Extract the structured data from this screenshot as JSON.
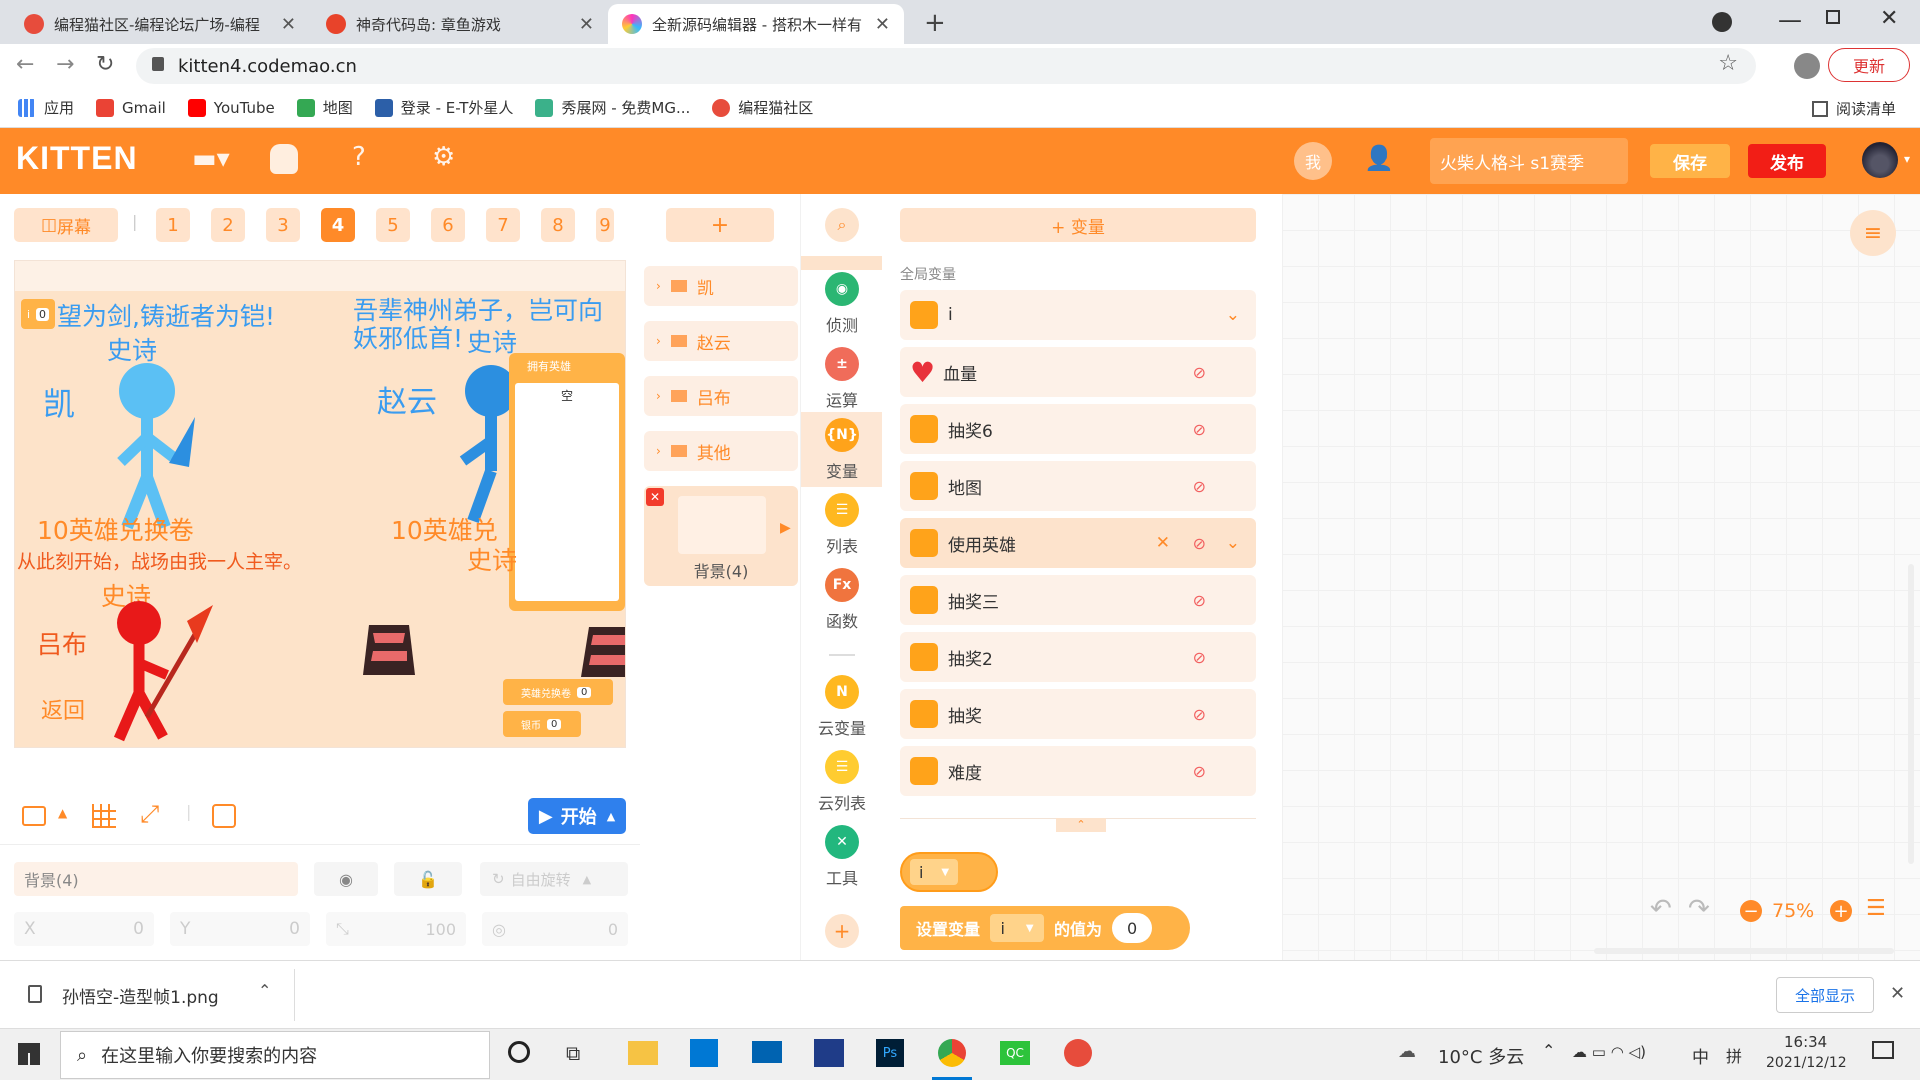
{
  "browser": {
    "tabs": [
      {
        "title": "编程猫社区-编程论坛广场-编程"
      },
      {
        "title": "神奇代码岛: 章鱼游戏"
      },
      {
        "title": "全新源码编辑器 - 搭积木一样有"
      }
    ],
    "url": "kitten4.codemao.cn",
    "update_label": "更新",
    "bookmarks": [
      "应用",
      "Gmail",
      "YouTube",
      "地图",
      "登录 - E-T外星人",
      "秀展网 - 免费MG...",
      "编程猫社区"
    ],
    "reading_list": "阅读清单"
  },
  "app": {
    "logo": "KITTEN",
    "me_label": "我",
    "project_name": "火柴人格斗  s1赛季",
    "save_label": "保存",
    "publish_label": "发布"
  },
  "stage": {
    "screen_label": "屏幕",
    "screens": [
      "1",
      "2",
      "3",
      "4",
      "5",
      "6",
      "7",
      "8",
      "9"
    ],
    "active_screen": "4",
    "var_monitor": {
      "name": "i",
      "value": "0"
    },
    "texts": {
      "quote1": "望为剑,铸逝者为铠!",
      "epic1": "史诗",
      "kai": "凯",
      "quote2_line1": "吾辈神州弟子，岂可向",
      "quote2_line2": "妖邪低首!",
      "epic2": "史诗",
      "zhaoyun": "赵云",
      "exchange1": "10英雄兑换卷",
      "exchange2": "10英雄兑",
      "quote3": "从此刻开始，战场由我一人主宰。",
      "epic3": "史诗",
      "epic4": "史诗",
      "lvbu": "吕布",
      "back": "返回"
    },
    "list_monitor": {
      "title": "拥有英雄",
      "item": "空"
    },
    "monitors": [
      {
        "name": "英雄兑换卷",
        "value": "0"
      },
      {
        "name": "银币",
        "value": "0"
      }
    ],
    "start_label": "开始",
    "sprite_name": "背景(4)",
    "rotate_label": "自由旋转",
    "props": {
      "x_label": "X",
      "x": "0",
      "y_label": "Y",
      "y": "0",
      "size": "100",
      "dir": "0"
    }
  },
  "sprites": {
    "add_label": "+",
    "folders": [
      "凯",
      "赵云",
      "吕布",
      "其他"
    ],
    "selected": "背景(4)"
  },
  "categories": [
    {
      "label": "侦测",
      "color": "#2bb673"
    },
    {
      "label": "运算",
      "color": "#f06c5a"
    },
    {
      "label": "变量",
      "color": "#ffa31a",
      "icon": "{N}"
    },
    {
      "label": "列表",
      "color": "#ffb820"
    },
    {
      "label": "函数",
      "color": "#f0743e",
      "icon": "Fx"
    },
    {
      "label": "云变量",
      "color": "#ffb820"
    },
    {
      "label": "云列表",
      "color": "#ffcc30"
    },
    {
      "label": "工具",
      "color": "#22b77e"
    }
  ],
  "variables": {
    "add_label": "+ 变量",
    "section": "全局变量",
    "items": [
      "i",
      "血量",
      "抽奖6",
      "地图",
      "使用英雄",
      "抽奖三",
      "抽奖2",
      "抽奖",
      "难度"
    ],
    "block_var": "i",
    "set_block": {
      "prefix": "设置变量",
      "var": "i",
      "mid": "的值为",
      "value": "0"
    }
  },
  "workspace": {
    "zoom": "75%"
  },
  "downloads": {
    "file": "孙悟空-造型帧1.png",
    "show_all": "全部显示"
  },
  "taskbar": {
    "search": "在这里输入你要搜索的内容",
    "weather": "10°C 多云",
    "ime": "中",
    "time": "16:34",
    "date": "2021/12/12"
  }
}
